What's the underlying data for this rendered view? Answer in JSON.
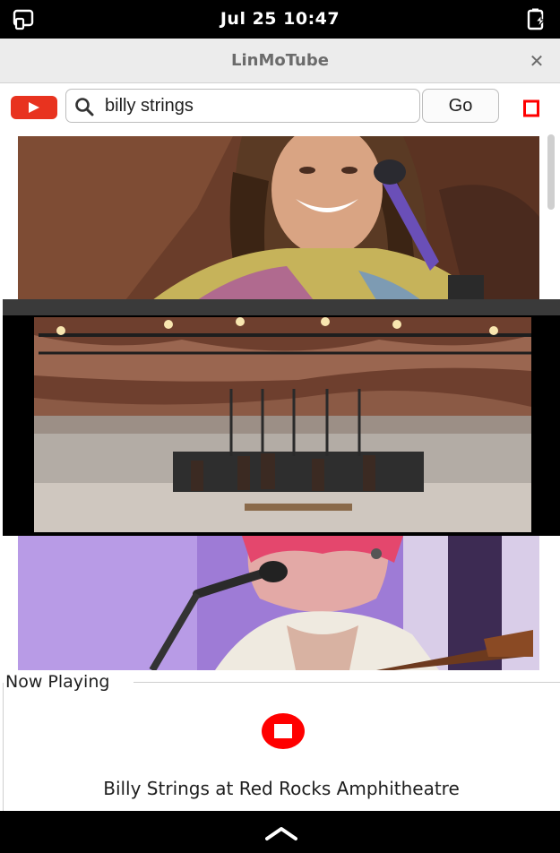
{
  "status_bar": {
    "time": "Jul 25  10:47"
  },
  "window": {
    "title": "LinMoTube",
    "close_glyph": "✕"
  },
  "toolbar": {
    "logo_icon": "youtube-logo-icon",
    "search_icon": "magnifier-icon",
    "search_value": "billy strings",
    "go_label": "Go",
    "stop_icon": "stop-icon"
  },
  "results": [
    {
      "thumbnail": "close-up of smiling long-haired singer at microphone"
    },
    {
      "thumbnail": "wide shot of band on Red Rocks amphitheatre stage"
    },
    {
      "thumbnail": "pink-haired guitarist singing into microphone"
    }
  ],
  "now_playing": {
    "label": "Now Playing",
    "stop_icon": "stop-icon",
    "title": "Billy Strings at Red Rocks Amphitheatre"
  },
  "bottom_bar": {
    "icon": "chevron-up-icon"
  },
  "colors": {
    "accent_red": "#e8331f",
    "stop_red": "#ff0000"
  }
}
